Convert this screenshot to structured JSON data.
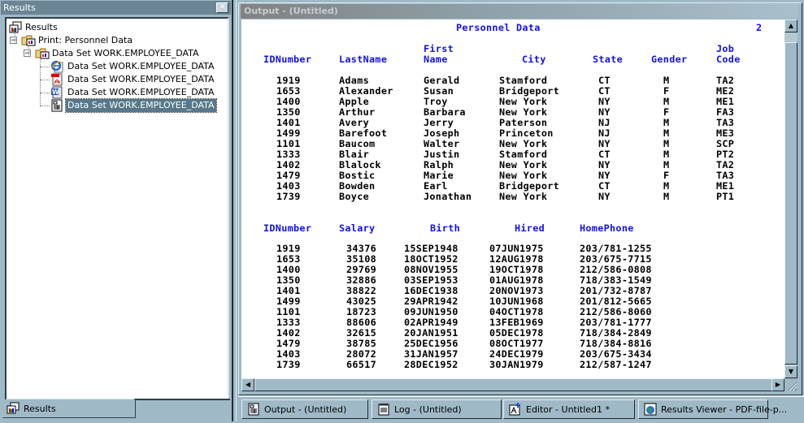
{
  "results_pane": {
    "title": "Results",
    "close_icon": "close-icon",
    "tree": [
      {
        "label": "Results",
        "icon": "results-icon",
        "level": 0
      },
      {
        "label": "Print:  Personnel Data",
        "icon": "folder-output-icon",
        "level": 1,
        "expanded": true
      },
      {
        "label": "Data Set WORK.EMPLOYEE_DATA",
        "icon": "folder-output-icon",
        "level": 2,
        "expanded": true
      },
      {
        "label": "Data Set WORK.EMPLOYEE_DATA",
        "icon": "html-ie-icon",
        "level": 3
      },
      {
        "label": "Data Set WORK.EMPLOYEE_DATA",
        "icon": "pdf-icon",
        "level": 3
      },
      {
        "label": "Data Set WORK.EMPLOYEE_DATA",
        "icon": "rtf-word-icon",
        "level": 3
      },
      {
        "label": "Data Set WORK.EMPLOYEE_DATA",
        "icon": "listing-icon",
        "level": 3,
        "selected": true
      }
    ],
    "bottom_tab": "Results",
    "expander_symbol": "−"
  },
  "output_window": {
    "title": "Output - (Untitled)",
    "report_title": "Personnel Data",
    "page_number": "2",
    "table1": {
      "headers": [
        {
          "top": "",
          "bottom": "IDNumber"
        },
        {
          "top": "",
          "bottom": "LastName"
        },
        {
          "top": "First",
          "bottom": "Name"
        },
        {
          "top": "",
          "bottom": "City"
        },
        {
          "top": "",
          "bottom": "State"
        },
        {
          "top": "",
          "bottom": "Gender"
        },
        {
          "top": "Job",
          "bottom": "Code"
        }
      ],
      "rows": [
        [
          "1919",
          "Adams",
          "Gerald",
          "Stamford",
          "CT",
          "M",
          "TA2"
        ],
        [
          "1653",
          "Alexander",
          "Susan",
          "Bridgeport",
          "CT",
          "F",
          "ME2"
        ],
        [
          "1400",
          "Apple",
          "Troy",
          "New York",
          "NY",
          "M",
          "ME1"
        ],
        [
          "1350",
          "Arthur",
          "Barbara",
          "New York",
          "NY",
          "F",
          "FA3"
        ],
        [
          "1401",
          "Avery",
          "Jerry",
          "Paterson",
          "NJ",
          "M",
          "TA3"
        ],
        [
          "1499",
          "Barefoot",
          "Joseph",
          "Princeton",
          "NJ",
          "M",
          "ME3"
        ],
        [
          "1101",
          "Baucom",
          "Walter",
          "New York",
          "NY",
          "M",
          "SCP"
        ],
        [
          "1333",
          "Blair",
          "Justin",
          "Stamford",
          "CT",
          "M",
          "PT2"
        ],
        [
          "1402",
          "Blalock",
          "Ralph",
          "New York",
          "NY",
          "M",
          "TA2"
        ],
        [
          "1479",
          "Bostic",
          "Marie",
          "New York",
          "NY",
          "F",
          "TA3"
        ],
        [
          "1403",
          "Bowden",
          "Earl",
          "Bridgeport",
          "CT",
          "M",
          "ME1"
        ],
        [
          "1739",
          "Boyce",
          "Jonathan",
          "New York",
          "NY",
          "M",
          "PT1"
        ]
      ]
    },
    "table2": {
      "headers": [
        "IDNumber",
        "Salary",
        "Birth",
        "Hired",
        "HomePhone"
      ],
      "rows": [
        [
          "1919",
          "34376",
          "15SEP1948",
          "07JUN1975",
          "203/781-1255"
        ],
        [
          "1653",
          "35108",
          "18OCT1952",
          "12AUG1978",
          "203/675-7715"
        ],
        [
          "1400",
          "29769",
          "08NOV1955",
          "19OCT1978",
          "212/586-0808"
        ],
        [
          "1350",
          "32886",
          "03SEP1953",
          "01AUG1978",
          "718/383-1549"
        ],
        [
          "1401",
          "38822",
          "16DEC1938",
          "20NOV1973",
          "201/732-8787"
        ],
        [
          "1499",
          "43025",
          "29APR1942",
          "10JUN1968",
          "201/812-5665"
        ],
        [
          "1101",
          "18723",
          "09JUN1950",
          "04OCT1978",
          "212/586-8060"
        ],
        [
          "1333",
          "88606",
          "02APR1949",
          "13FEB1969",
          "203/781-1777"
        ],
        [
          "1402",
          "32615",
          "20JAN1951",
          "05DEC1978",
          "718/384-2849"
        ],
        [
          "1479",
          "38785",
          "25DEC1956",
          "08OCT1977",
          "718/384-8816"
        ],
        [
          "1403",
          "28072",
          "31JAN1957",
          "24DEC1979",
          "203/675-3434"
        ],
        [
          "1739",
          "66517",
          "28DEC1952",
          "30JAN1979",
          "212/587-1247"
        ]
      ]
    },
    "scroll": {
      "up": "▲",
      "down": "▼",
      "left": "◀",
      "right": "▶"
    }
  },
  "taskbar": [
    {
      "label": "Output - (Untitled)",
      "icon": "output-icon"
    },
    {
      "label": "Log - (Untitled)",
      "icon": "log-icon"
    },
    {
      "label": "Editor - Untitled1 *",
      "icon": "editor-icon"
    },
    {
      "label": "Results Viewer - PDF-file-p...",
      "icon": "results-viewer-icon"
    }
  ],
  "colors": {
    "header_blue": "#1111ee",
    "selection": "#56788a",
    "chrome": "#9fb9c7"
  }
}
